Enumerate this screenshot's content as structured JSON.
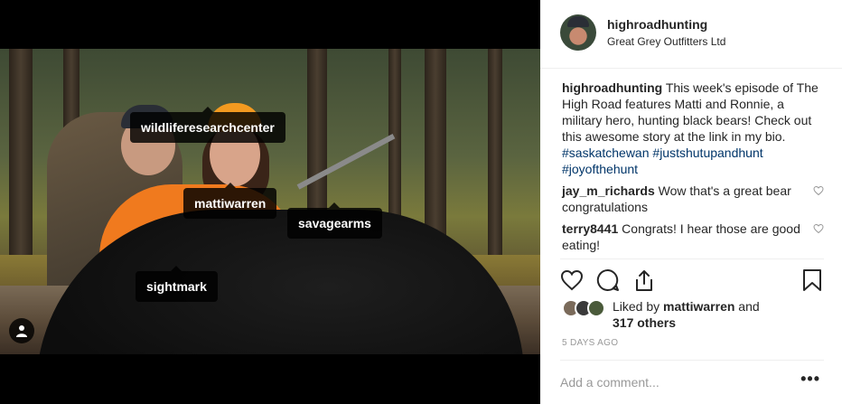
{
  "photo": {
    "tags": [
      "wildliferesearchcenter",
      "mattiwarren",
      "savagearms",
      "sightmark"
    ]
  },
  "post": {
    "username": "highroadhunting",
    "location": "Great Grey Outfitters Ltd",
    "caption": {
      "author": "highroadhunting",
      "text": "This week's episode of The High Road features Matti and Ronnie, a military hero, hunting black bears! Check out this awesome story at the link in my bio.",
      "hashtags": [
        "#saskatchewan",
        "#justshutupandhunt",
        "#joyofthehunt"
      ]
    },
    "comments": [
      {
        "user": "jay_m_richards",
        "text": "Wow that's a great bear congratulations"
      },
      {
        "user": "terry8441",
        "text": "Congrats! I hear those are good eating!"
      }
    ],
    "likes": {
      "prefix": "Liked by",
      "user": "mattiwarren",
      "conj": "and",
      "others": "317 others"
    },
    "time": "5 DAYS AGO",
    "comment_placeholder": "Add a comment...",
    "more": "•••"
  },
  "icons": {
    "like": "heart-icon",
    "comment": "comment-icon",
    "share": "share-icon",
    "save": "bookmark-icon",
    "user_tags": "person-icon"
  }
}
